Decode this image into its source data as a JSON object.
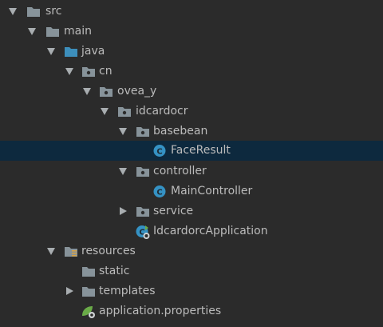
{
  "tree": {
    "src": "src",
    "main": "main",
    "java": "java",
    "cn": "cn",
    "ovea_y": "ovea_y",
    "idcardocr": "idcardocr",
    "basebean": "basebean",
    "face_result": "FaceResult",
    "controller": "controller",
    "main_controller": "MainController",
    "service": "service",
    "application_class": "IdcardorcApplication",
    "resources": "resources",
    "static": "static",
    "templates": "templates",
    "application_properties": "application.properties"
  },
  "colors": {
    "background": "#2b2b2b",
    "selection": "#0d293e",
    "text": "#bbbbbb",
    "folder": "#87939a",
    "source_folder": "#3d8fbc",
    "class_icon": "#3592c4",
    "spring_green": "#6aab48"
  },
  "icons": {
    "module_folder": "folder-icon",
    "source_root": "source-folder-icon",
    "package": "package-icon",
    "class": "class-icon",
    "spring_boot_class": "spring-class-icon",
    "resources_root": "resources-folder-icon",
    "properties_file": "spring-properties-icon"
  }
}
